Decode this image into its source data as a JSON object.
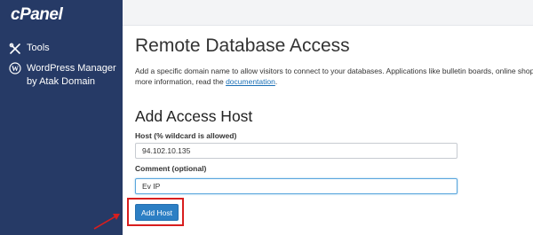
{
  "sidebar": {
    "logo": "cPanel",
    "items": [
      {
        "label": "Tools",
        "icon": "tools-icon"
      },
      {
        "label_line1": "WordPress Manager",
        "label_line2": "by Atak Domain",
        "icon": "wordpress-icon"
      }
    ],
    "bg_color": "#263a66"
  },
  "page": {
    "title": "Remote Database Access",
    "intro_line1": "Add a specific domain name to allow visitors to connect to your databases. Applications like bulletin boards, online shoppi",
    "intro_line2_prefix": "more information, read the",
    "intro_link": "documentation",
    "intro_line2_suffix": "."
  },
  "form": {
    "section_title": "Add Access Host",
    "host_label": "Host (% wildcard is allowed)",
    "host_value": "94.102.10.135",
    "comment_label": "Comment (optional)",
    "comment_value": "Ev IP",
    "submit_label": "Add Host"
  },
  "colors": {
    "accent": "#2c7fc4",
    "highlight": "#d81e1e",
    "link": "#1a6fb5"
  }
}
